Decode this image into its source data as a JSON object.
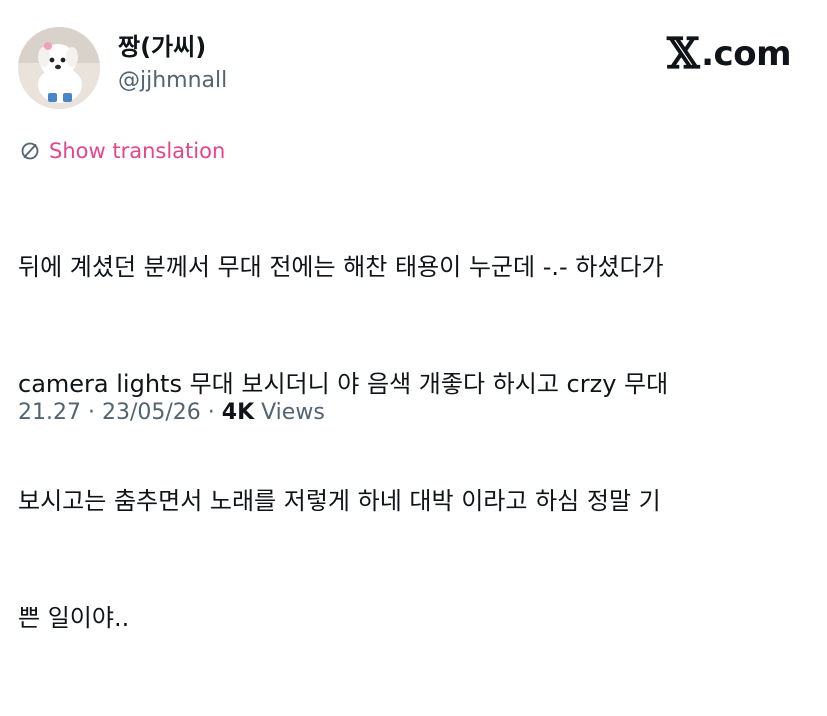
{
  "user": {
    "display_name": "짱(가씨)",
    "handle": "@jjhmnall"
  },
  "brand": {
    "x_glyph": "𝕏",
    "suffix": ".com"
  },
  "translate": {
    "icon": "globe-icon",
    "label": "Show translation",
    "color": "#e5458a"
  },
  "tweet": {
    "lines": [
      "뒤에 계셨던 분께서 무대 전에는 해찬 태용이 누군데 -.- 하셨다가",
      "camera lights 무대 보시더니 야 음색 개좋다 하시고 crzy 무대",
      "보시고는 춤추면서 노래를 저렇게 하네 대박 이라고 하심 정말 기",
      "쁜 일이야.."
    ]
  },
  "meta": {
    "time": "21.27",
    "sep1": " · ",
    "date": "23/05/26",
    "sep2": " · ",
    "views_count": "4K",
    "views_label": " Views"
  }
}
